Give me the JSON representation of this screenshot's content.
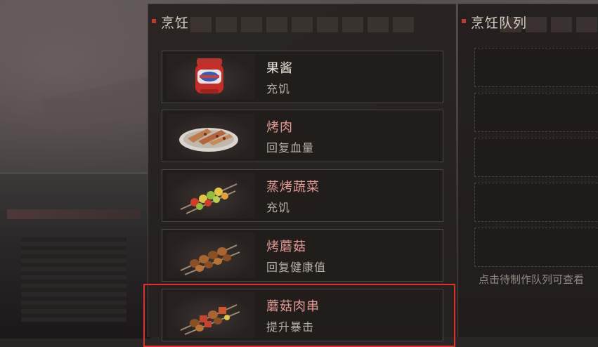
{
  "cooking_panel": {
    "title": "烹饪",
    "recipes": [
      {
        "name": "果酱",
        "effect": "充饥",
        "name_color": "white",
        "icon": "jam-jar-icon"
      },
      {
        "name": "烤肉",
        "effect": "回复血量",
        "name_color": "pink",
        "icon": "roast-meat-plate-icon"
      },
      {
        "name": "蒸烤蔬菜",
        "effect": "充饥",
        "name_color": "pink",
        "icon": "vegetable-skewer-icon"
      },
      {
        "name": "烤蘑菇",
        "effect": "回复健康值",
        "name_color": "pink",
        "icon": "mushroom-skewer-icon"
      },
      {
        "name": "蘑菇肉串",
        "effect": "提升暴击",
        "name_color": "pink",
        "icon": "mushroom-meat-skewer-icon"
      }
    ],
    "highlighted_recipe": "蘑菇肉串"
  },
  "queue_panel": {
    "title": "烹饪队列",
    "slot_count": 5,
    "hint": "点击待制作队列可查看"
  },
  "colors": {
    "accent_red": "#e0312a",
    "title_marker": "#c0392b",
    "name_pink": "#e39a91",
    "name_white": "#ece6dc"
  }
}
